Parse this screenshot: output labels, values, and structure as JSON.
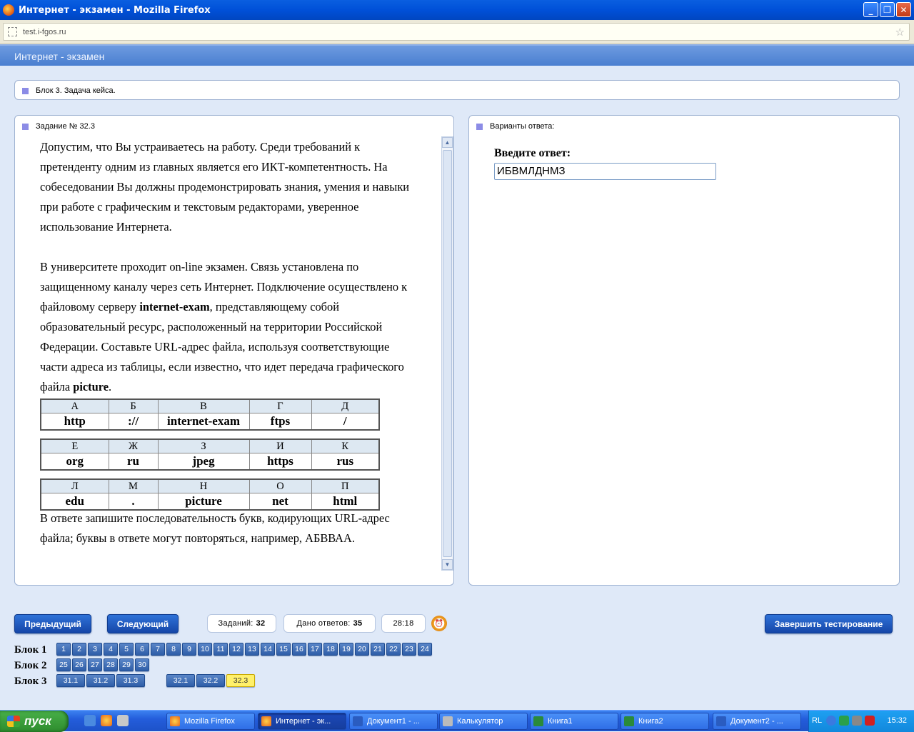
{
  "window": {
    "title": "Интернет - экзамен - Mozilla Firefox",
    "url": "test.i-fgos.ru"
  },
  "app": {
    "header": "Интернет - экзамен"
  },
  "block_title": "Блок 3. Задача кейса.",
  "task": {
    "title": "Задание № 32.3",
    "para1": "Допустим, что Вы устраиваетесь на работу. Среди требований к претенденту одним из главных является его ИКТ-компетентность. На собеседовании Вы должны продемонстрировать знания, умения и навыки при работе с графическим и текстовым редакторами, уверенное использование Интернета.",
    "para2_a": "В университете проходит on-line экзамен. Связь установлена по защищенному каналу через сеть Интернет. Подключение осуществлено к файловому серверу ",
    "para2_b": "internet-exam",
    "para2_c": ", представляющему собой образовательный ресурс, расположенный на территории Российской Федерации. Составьте URL-адрес файла, используя соответствующие части адреса из таблицы, если известно, что идет передача графического файла ",
    "para2_d": "picture",
    "para2_e": ".",
    "tables": [
      {
        "letters": [
          "А",
          "Б",
          "В",
          "Г",
          "Д"
        ],
        "values": [
          "http",
          "://",
          "internet-exam",
          "ftps",
          "/"
        ]
      },
      {
        "letters": [
          "Е",
          "Ж",
          "З",
          "И",
          "К"
        ],
        "values": [
          "org",
          "ru",
          "jpeg",
          "https",
          "rus"
        ]
      },
      {
        "letters": [
          "Л",
          "М",
          "Н",
          "О",
          "П"
        ],
        "values": [
          "edu",
          ".",
          "picture",
          "net",
          "html"
        ]
      }
    ],
    "para3": "В ответе запишите последовательность букв, кодирующих URL-адрес файла; буквы в ответе могут повторяться, например, АБВВАА."
  },
  "answer": {
    "title": "Варианты ответа:",
    "label": "Введите ответ:",
    "value": "ИБВМЛДНМЗ"
  },
  "nav": {
    "prev": "Предыдущий",
    "next": "Следующий",
    "tasks_label": "Заданий:",
    "tasks_value": "32",
    "answers_label": "Дано ответов:",
    "answers_value": "35",
    "timer": "28:18",
    "finish": "Завершить тестирование"
  },
  "blocks": [
    {
      "label": "Блок 1",
      "items": [
        "1",
        "2",
        "3",
        "4",
        "5",
        "6",
        "7",
        "8",
        "9",
        "10",
        "11",
        "12",
        "13",
        "14",
        "15",
        "16",
        "17",
        "18",
        "19",
        "20",
        "21",
        "22",
        "23",
        "24"
      ]
    },
    {
      "label": "Блок 2",
      "items": [
        "25",
        "26",
        "27",
        "28",
        "29",
        "30"
      ]
    },
    {
      "label": "Блок 3",
      "items_a": [
        "31.1",
        "31.2",
        "31.3"
      ],
      "items_b": [
        "32.1",
        "32.2",
        "32.3"
      ],
      "current": "32.3"
    }
  ],
  "taskbar": {
    "start": "пуск",
    "items": [
      "Mozilla Firefox",
      "Интернет - эк...",
      "Документ1 - ...",
      "Калькулятор",
      "Книга1",
      "Книга2",
      "Документ2 - ..."
    ],
    "lang": "RL",
    "time": "15:32"
  }
}
